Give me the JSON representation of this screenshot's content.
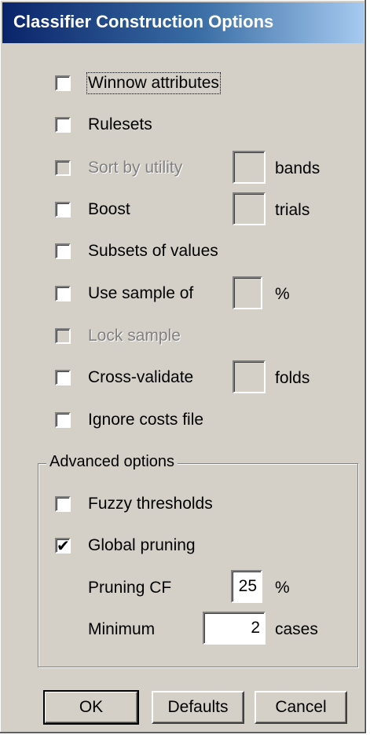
{
  "window": {
    "title": "Classifier Construction Options"
  },
  "options": {
    "winnow": {
      "label": "Winnow attributes",
      "checked": false,
      "enabled": true
    },
    "rulesets": {
      "label": "Rulesets",
      "checked": false,
      "enabled": true
    },
    "sort_by_utility": {
      "label": "Sort by utility",
      "checked": false,
      "enabled": false,
      "value": "",
      "unit": "bands"
    },
    "boost": {
      "label": "Boost",
      "checked": false,
      "enabled": true,
      "value": "",
      "unit": "trials"
    },
    "subsets": {
      "label": "Subsets of values",
      "checked": false,
      "enabled": true
    },
    "use_sample": {
      "label": "Use sample of",
      "checked": false,
      "enabled": true,
      "value": "",
      "unit": "%"
    },
    "lock_sample": {
      "label": "Lock sample",
      "checked": false,
      "enabled": false
    },
    "cross_validate": {
      "label": "Cross-validate",
      "checked": false,
      "enabled": true,
      "value": "",
      "unit": "folds"
    },
    "ignore_costs": {
      "label": "Ignore costs file",
      "checked": false,
      "enabled": true
    }
  },
  "advanced": {
    "group_label": "Advanced options",
    "fuzzy": {
      "label": "Fuzzy thresholds",
      "checked": false
    },
    "global_pruning": {
      "label": "Global pruning",
      "checked": true,
      "check_glyph": "✔"
    },
    "pruning_cf": {
      "label": "Pruning CF",
      "value": "25",
      "unit": "%"
    },
    "minimum": {
      "label": "Minimum",
      "value": "2",
      "unit": "cases"
    }
  },
  "buttons": {
    "ok": "OK",
    "defaults": "Defaults",
    "cancel": "Cancel"
  },
  "colors": {
    "dialog_bg": "#d4d0c8",
    "titlebar": "#0a246a",
    "disabled_text": "#808080"
  }
}
